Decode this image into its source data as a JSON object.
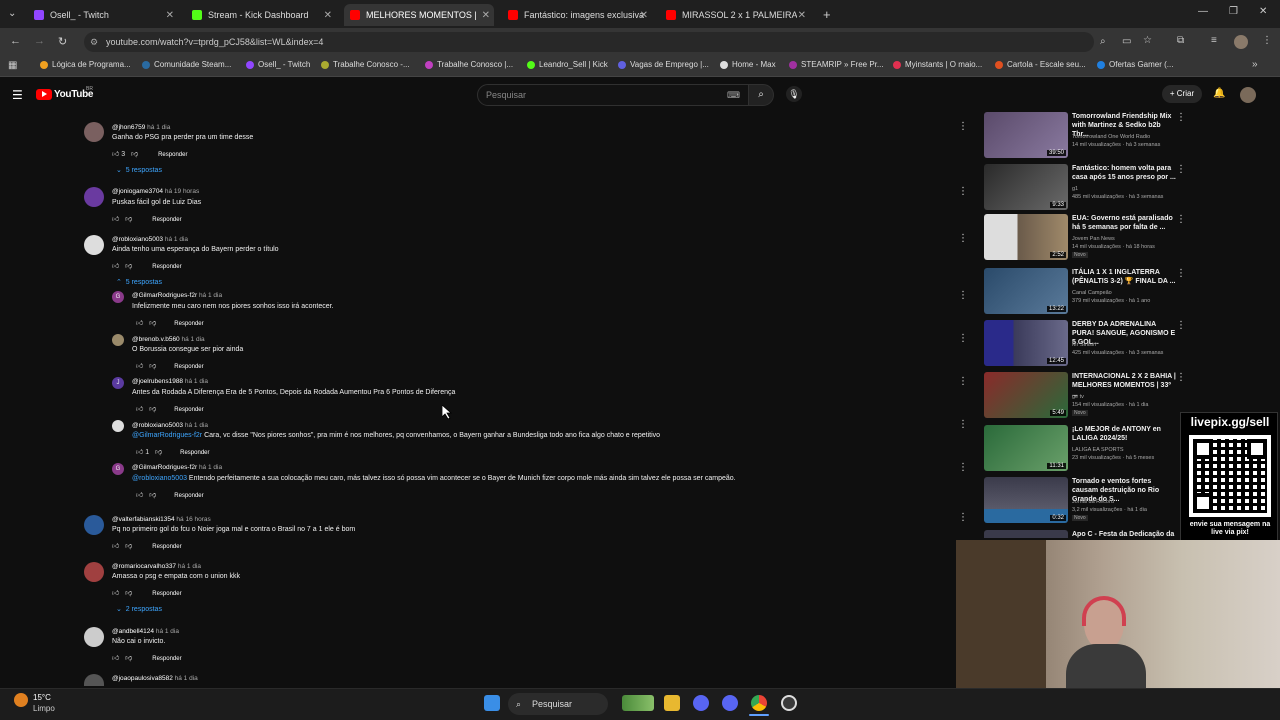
{
  "browser": {
    "tabs": [
      {
        "title": "Osell_ - Twitch",
        "color": "#9146ff"
      },
      {
        "title": "Stream - Kick Dashboard",
        "color": "#53fc18"
      },
      {
        "title": "MELHORES MOMENTOS | ...",
        "color": "#ff0000"
      },
      {
        "title": "Fantástico: imagens exclusivas ...",
        "color": "#ff0000"
      },
      {
        "title": "MIRASSOL 2 x 1 PALMEIRAS | ...",
        "color": "#ff0000"
      }
    ],
    "url": "youtube.com/watch?v=tprdg_pCJ58&list=WL&index=4",
    "bookmarks": [
      "Lógica de Programa...",
      "Comunidade Steam...",
      "Osell_ - Twitch",
      "Trabalhe Conosco -...",
      "Trabalhe Conosco |...",
      "Leandro_Sell | Kick",
      "Vagas de Emprego |...",
      "Home - Max",
      "STEAMRIP » Free Pr...",
      "Myinstants | O maio...",
      "Cartola - Escale seu...",
      "Ofertas Gamer (..."
    ]
  },
  "youtube": {
    "logo": "YouTube",
    "region": "BR",
    "search_placeholder": "Pesquisar",
    "create_label": "Criar"
  },
  "comments": [
    {
      "author": "@jhon6759",
      "time": "há 1 dia",
      "text": "Ganha do PSG pra perder pra um time desse",
      "likes": "3",
      "reply": "Responder",
      "replies": "5 respostas",
      "avatar": "#7a6060"
    },
    {
      "author": "@joniogame3704",
      "time": "há 19 horas",
      "text": "Puskas fácil gol de Luiz Dias",
      "likes": "",
      "reply": "Responder",
      "replies": "",
      "avatar": "#6a3aa0"
    },
    {
      "author": "@robloxiano5003",
      "time": "há 1 dia",
      "text": "Ainda tenho uma esperança do Bayern perder o título",
      "likes": "",
      "reply": "Responder",
      "replies": "5 respostas",
      "avatar": "#dddddd"
    },
    {
      "author": "@valterfabianski1354",
      "time": "há 16 horas",
      "text": "Pq no primeiro gol do  fcu o Noier joga mal e contra o Brasil no 7 a 1 ele é bom",
      "likes": "",
      "reply": "Responder",
      "replies": "",
      "avatar": "#2a5a9a"
    },
    {
      "author": "@romariocarvalho337",
      "time": "há 1 dia",
      "text": "Amassa o psg e empata com o union kkk",
      "likes": "",
      "reply": "Responder",
      "replies": "2 respostas",
      "avatar": "#a04040"
    },
    {
      "author": "@andbell4124",
      "time": "há 1 dia",
      "text": "Não cai o invicto.",
      "likes": "",
      "reply": "Responder",
      "replies": "",
      "avatar": "#cccccc"
    },
    {
      "author": "@joaopaulosiva8582",
      "time": "há 1 dia",
      "text": "",
      "likes": "",
      "reply": "",
      "replies": "",
      "avatar": "#555555"
    }
  ],
  "replies": [
    {
      "author": "@GilmarRodrigues-f2r",
      "time": "há 1 dia",
      "text": "Infelizmente meu caro nem nos piores sonhos  isso irá acontecer.",
      "mention": "",
      "likes": "",
      "reply": "Responder",
      "avatar": "#8a3a8a",
      "initial": "G"
    },
    {
      "author": "@brenob.v.b560",
      "time": "há 1 dia",
      "text": "O Borussia consegue ser pior ainda",
      "mention": "",
      "likes": "",
      "reply": "Responder",
      "avatar": "#9a8a6a",
      "initial": ""
    },
    {
      "author": "@joelrubens1988",
      "time": "há 1 dia",
      "text": "Antes da Rodada A Diferença Era de 5 Pontos, Depois da Rodada Aumentou Pra 6 Pontos de Diferença",
      "mention": "",
      "likes": "",
      "reply": "Responder",
      "avatar": "#5a3aa0",
      "initial": "J"
    },
    {
      "author": "@robloxiano5003",
      "time": "há 1 dia",
      "text": " Cara, vc disse \"Nos piores sonhos\", pra mim é nos melhores, pq convenhamos, o Bayern ganhar a Bundesliga todo ano fica algo chato e repetitivo",
      "mention": "@GilmarRodrigues-f2r",
      "likes": "1",
      "reply": "Responder",
      "avatar": "#dddddd",
      "initial": ""
    },
    {
      "author": "@GilmarRodrigues-f2r",
      "time": "há 1 dia",
      "text": " Entendo perfeitamente a sua colocação meu caro, más  talvez  isso  só  possa vim acontecer  se o Bayer de Munich  fizer  corpo mole  más  ainda sim talvez ele  possa  ser  campeão.",
      "mention": "@robloxiano5003",
      "likes": "",
      "reply": "Responder",
      "avatar": "#8a3a8a",
      "initial": "G"
    }
  ],
  "sidebar_videos": [
    {
      "title": "Tomorrowland Friendship Mix with Martinez & Sedko b2b Thr...",
      "channel": "Tomorrowland One World Radio",
      "meta": "14 mil visualizações · há 3 semanas",
      "duration": "39:50",
      "new": "",
      "thumb": "#5a4a6a"
    },
    {
      "title": "Fantástico: homem volta para casa após 15 anos preso por ...",
      "channel": "g1",
      "meta": "485 mil visualizações · há 3 semanas",
      "duration": "9:33",
      "new": "",
      "thumb": "#3a3a3a"
    },
    {
      "title": "EUA: Governo está paralisado há 5 semanas por falta de ...",
      "channel": "Jovem Pan News",
      "meta": "14 mil visualizações · há 18 horas",
      "duration": "2:52",
      "new": "Novo",
      "thumb": "#6a5a4a"
    },
    {
      "title": "ITÁLIA 1 X 1 INGLATERRA (PÊNALTIS 3-2) 🏆 FINAL DA ...",
      "channel": "Canal Campeão",
      "meta": "379 mil visualizações · há 1 ano",
      "duration": "13:22",
      "new": "",
      "thumb": "#2a4a6a"
    },
    {
      "title": "DERBY DA ADRENALINA PURA! SANGUE, AGONISMO E 5 GOL...",
      "channel": "Mr Sinisiri",
      "meta": "425 mil visualizações · há 3 semanas",
      "duration": "12:45",
      "new": "",
      "thumb": "#3a3a7a"
    },
    {
      "title": "INTERNACIONAL 2 X 2 BAHIA | MELHORES MOMENTOS | 33º ...",
      "channel": "ge tv",
      "meta": "154 mil visualizações · há 1 dia",
      "duration": "5:49",
      "new": "Novo",
      "thumb": "#7a2a2a"
    },
    {
      "title": "¡Lo MEJOR de ANTONY en LALIGA 2024/25!",
      "channel": "LALIGA EA SPORTS",
      "meta": "23 mil visualizações · há 5 meses",
      "duration": "11:31",
      "new": "",
      "thumb": "#3a6a3a"
    },
    {
      "title": "Tornado e ventos fortes causam destruição no Rio Grande do S...",
      "channel": "Jornal da Record",
      "meta": "3,2 mil visualizações · há 1 dia",
      "duration": "0:32",
      "new": "Novo",
      "thumb": "#4a4a5a"
    },
    {
      "title": "Apo C - Festa da Dedicação da ...",
      "channel": "",
      "meta": "",
      "duration": "",
      "new": "",
      "thumb": "#3a3a4a"
    }
  ],
  "overlay": {
    "qr_title": "livepix.gg/sell",
    "qr_caption": "envie sua mensagem na live via pix!"
  },
  "taskbar": {
    "weather_temp": "15°C",
    "weather_desc": "Limpo",
    "search_label": "Pesquisar"
  }
}
